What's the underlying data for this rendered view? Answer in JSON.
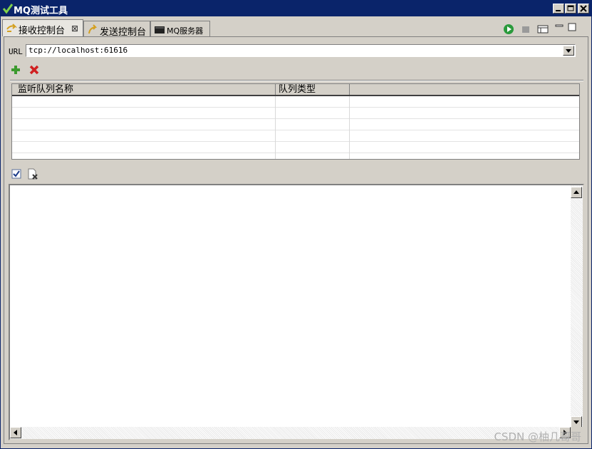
{
  "window": {
    "title": "MQ测试工具"
  },
  "tabs": [
    {
      "label": "接收控制台",
      "icon": "receive-icon",
      "active": true,
      "close": "⊠"
    },
    {
      "label": "发送控制台",
      "icon": "send-icon",
      "active": false
    },
    {
      "label": "MQ服务器",
      "icon": "server-icon",
      "active": false
    }
  ],
  "url": {
    "label": "URL",
    "value": "tcp://localhost:61616"
  },
  "table": {
    "columns": [
      "监听队列名称",
      "队列类型",
      ""
    ],
    "rows": [
      [
        "",
        "",
        ""
      ],
      [
        "",
        "",
        ""
      ],
      [
        "",
        "",
        ""
      ],
      [
        "",
        "",
        ""
      ],
      [
        "",
        "",
        ""
      ]
    ]
  },
  "icons": {
    "add": "add-icon",
    "remove": "remove-icon",
    "check": "checkbox-icon",
    "clear": "clear-log-icon",
    "run": "run-icon",
    "stop": "stop-icon",
    "view": "view-menu-icon"
  },
  "colors": {
    "titlebar": "#0a246a",
    "add": "#3c9a2e",
    "remove": "#d02020",
    "run": "#2a9a3c"
  },
  "watermark": "CSDN @柚几哥哥"
}
